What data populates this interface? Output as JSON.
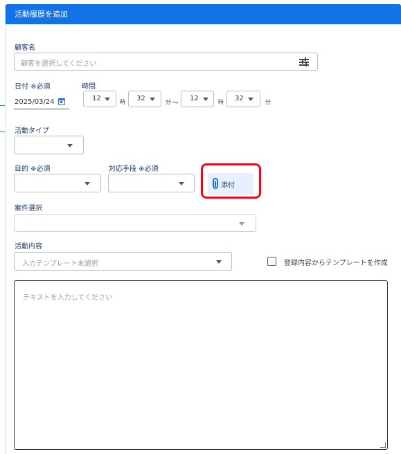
{
  "dialog": {
    "title": "活動履歴を追加"
  },
  "customer": {
    "label": "顧客名",
    "placeholder": "顧客を選択してください",
    "filter_icon": "tune-sliders-icon"
  },
  "date": {
    "label": "日付 ※必須",
    "value": "2025/03/24",
    "icon": "calendar-icon"
  },
  "time": {
    "label": "時間",
    "start_hour": "12",
    "hour_unit_1": "時",
    "start_minute": "32",
    "minute_unit_1": "分",
    "separator": "～",
    "end_hour": "12",
    "hour_unit_2": "時",
    "end_minute": "32",
    "minute_unit_2": "分"
  },
  "activity_type": {
    "label": "活動タイプ",
    "value": ""
  },
  "purpose": {
    "label": "目的 ※必須",
    "value": ""
  },
  "method": {
    "label": "対応手段 ※必須",
    "value": ""
  },
  "attach": {
    "label": "添付",
    "icon": "paperclip-icon",
    "highlight_color": "#e0101a"
  },
  "case": {
    "label": "案件選択",
    "value": ""
  },
  "content": {
    "label": "活動内容",
    "template_placeholder": "入力テンプレート未選択",
    "create_template_label": "登録内容からテンプレートを作成",
    "create_template_checked": false,
    "text_placeholder": "テキストを入力してください"
  },
  "colors": {
    "header": "#1272e8",
    "accent": "#1a73e8"
  }
}
